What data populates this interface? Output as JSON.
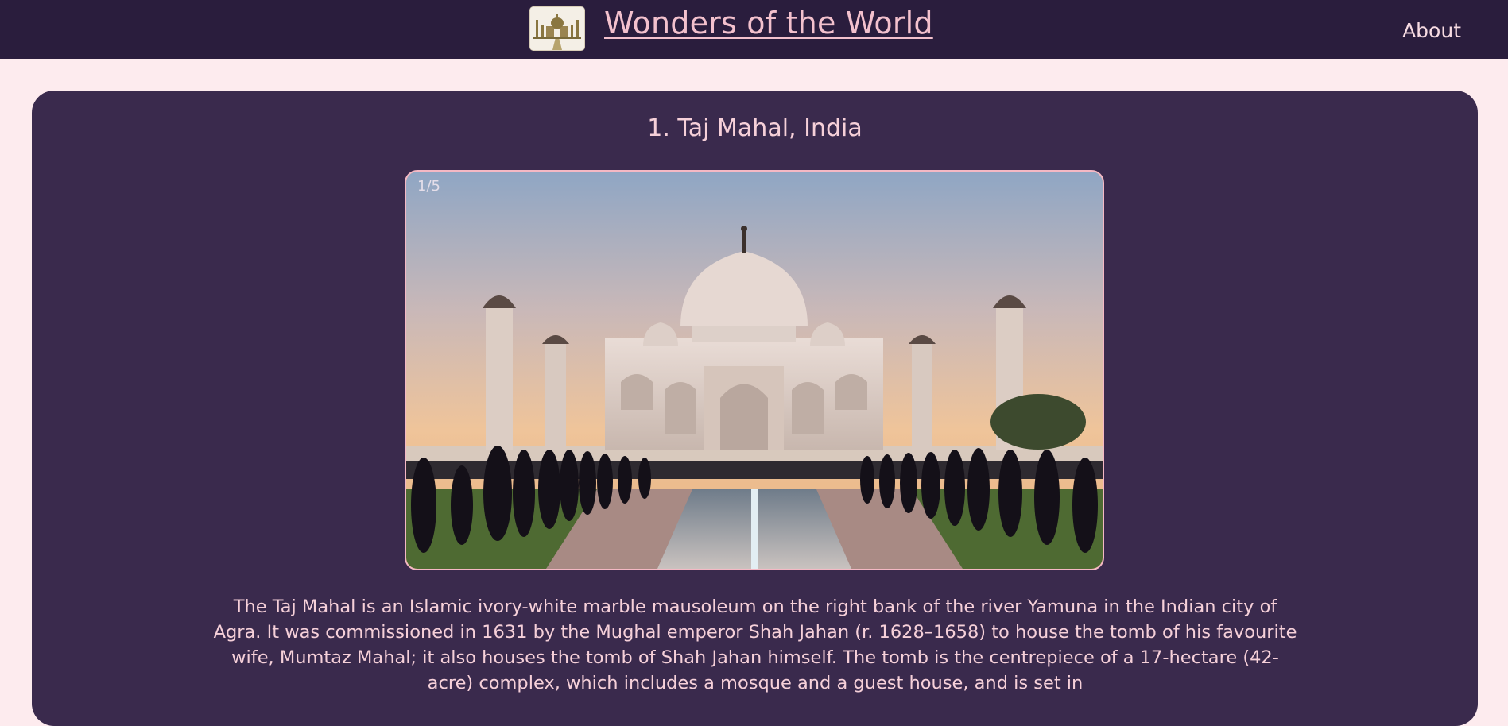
{
  "header": {
    "site_title": "Wonders of the World",
    "nav_about": "About"
  },
  "wonder": {
    "title": "1. Taj Mahal, India",
    "slide_counter": "1/5",
    "description": "The Taj Mahal is an Islamic ivory-white marble mausoleum on the right bank of the river Yamuna in the Indian city of Agra. It was commissioned in 1631 by the Mughal emperor Shah Jahan (r. 1628–1658) to house the tomb of his favourite wife, Mumtaz Mahal; it also houses the tomb of Shah Jahan himself. The tomb is the centrepiece of a 17-hectare (42-acre) complex, which includes a mosque and a guest house, and is set in"
  },
  "colors": {
    "header_bg": "#2a1d3d",
    "page_bg": "#fdebee",
    "card_bg": "#3a2a4d",
    "title_pink": "#f3c1cd",
    "slide_border": "#f4b8c4"
  }
}
